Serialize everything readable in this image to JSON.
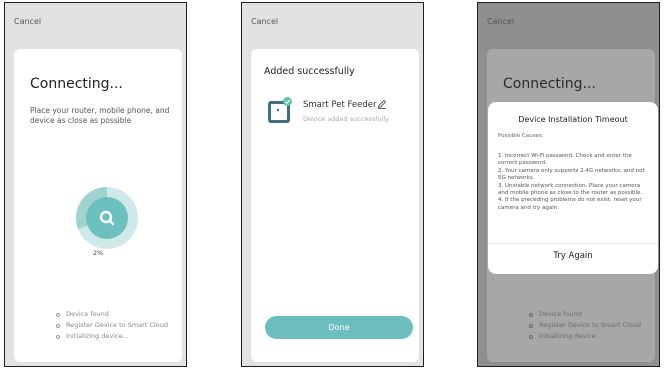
{
  "screens": [
    {
      "cancel": "Cancel",
      "title": "Connecting...",
      "subtitle": "Place your router, mobile phone, and device as close as possible",
      "progress_text": "2%",
      "progress_value": 0.02,
      "steps": [
        "Device found",
        "Register Device to Smart Cloud",
        "Initializing device..."
      ]
    },
    {
      "cancel": "Cancel",
      "title": "Added successfully",
      "device_name": "Smart Pet Feeder",
      "device_status": "Device added successfully",
      "done_label": "Done"
    },
    {
      "cancel": "Cancel",
      "title": "Connecting...",
      "steps": [
        "Device found",
        "Register Device to Smart Cloud",
        "Initializing device..."
      ],
      "dialog": {
        "title": "Device Installation Timeout",
        "causes_label": "Possible Causes:",
        "causes": [
          "1. Incorrect Wi-Fi password. Check and enter the correct password.",
          "2. Your camera only supports 2.4G networks, and not 5G networks.",
          "3. Unstable network connection. Place your camera and mobile phone as close to the router as possible.",
          "4. If the preceding problems do not exist, reset your camera and try again."
        ],
        "button": "Try Again"
      }
    }
  ],
  "colors": {
    "accent": "#6cc0bd",
    "accent_light": "#cfe9e9",
    "background": "#e2e2e2",
    "overlay_background": "#8f8f8f"
  }
}
